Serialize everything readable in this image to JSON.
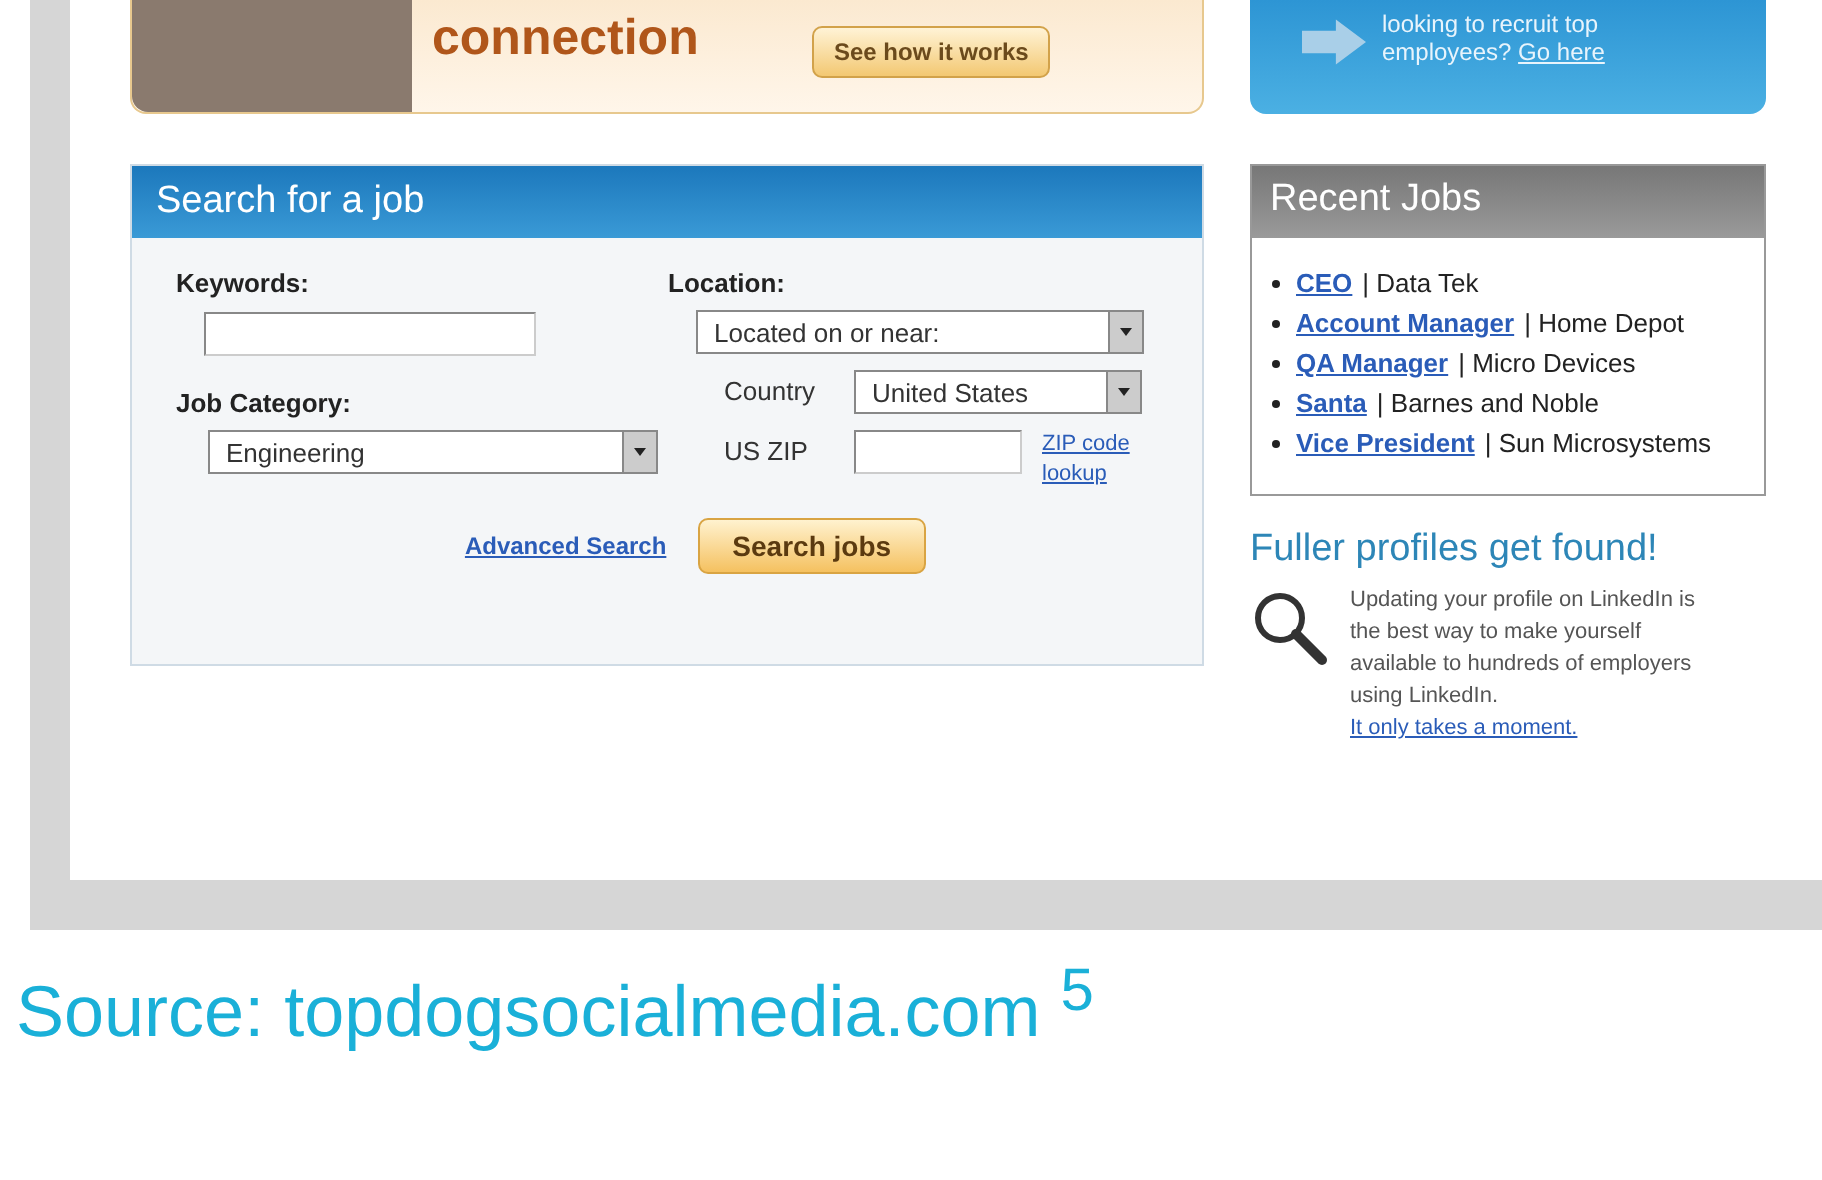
{
  "promo_banner": {
    "headline": "connection",
    "button": "See how it works"
  },
  "hiring_banner": {
    "text": "looking to recruit top employees?",
    "link": "Go here"
  },
  "job_search": {
    "title": "Search for a job",
    "keywords": {
      "label": "Keywords:"
    },
    "location": {
      "label": "Location:",
      "value": "Located on or near:"
    },
    "job_category": {
      "label": "Job Category:",
      "value": "Engineering"
    },
    "country": {
      "label": "Country",
      "value": "United States"
    },
    "zip": {
      "label": "US ZIP",
      "lookup_link": "ZIP code lookup"
    },
    "advanced_link": "Advanced Search",
    "search_button": "Search jobs"
  },
  "recent_jobs": {
    "title": "Recent Jobs",
    "items": [
      {
        "title": "CEO",
        "company": "| Data Tek"
      },
      {
        "title": "Account Manager",
        "company": "| Home Depot"
      },
      {
        "title": "QA Manager",
        "company": "| Micro Devices"
      },
      {
        "title": "Santa",
        "company": "| Barnes and Noble"
      },
      {
        "title": "Vice President",
        "company": "| Sun Microsystems"
      }
    ]
  },
  "profile_promo": {
    "title": "Fuller profiles get found!",
    "text": "Updating your profile on LinkedIn is the best way to make yourself available to hundreds of employers using LinkedIn.",
    "link": "It only takes a moment."
  },
  "source": "Source: topdogsocialmedia.com $^{5}$"
}
